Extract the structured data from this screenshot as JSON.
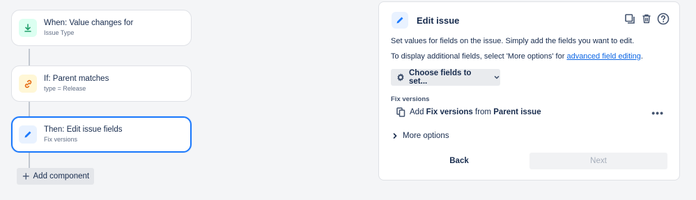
{
  "rule": {
    "trigger": {
      "title": "When: Value changes for",
      "subtitle": "Issue Type",
      "icon": "download-arrow-icon",
      "color": "#22a06b"
    },
    "condition": {
      "title": "If: Parent matches",
      "subtitle": "type = Release",
      "icon": "link-icon",
      "color": "#e56910"
    },
    "action": {
      "title": "Then: Edit issue fields",
      "subtitle": "Fix versions",
      "icon": "pencil-icon",
      "color": "#1d7afc"
    },
    "add_component_label": "Add component"
  },
  "panel": {
    "title": "Edit issue",
    "description": "Set values for fields on the issue. Simply add the fields you want to edit.",
    "additional_prefix": "To display additional fields, select 'More options' for ",
    "additional_link": "advanced field editing",
    "additional_suffix": ".",
    "choose_fields_label": "Choose fields to set...",
    "section_label": "Fix versions",
    "field_row": {
      "prefix": "Add ",
      "field": "Fix versions",
      "middle": " from ",
      "source": "Parent issue"
    },
    "more_options_label": "More options",
    "back_label": "Back",
    "next_label": "Next"
  },
  "colors": {
    "accent": "#1d7afc",
    "link": "#0c66e4",
    "background": "#f4f5f7"
  }
}
